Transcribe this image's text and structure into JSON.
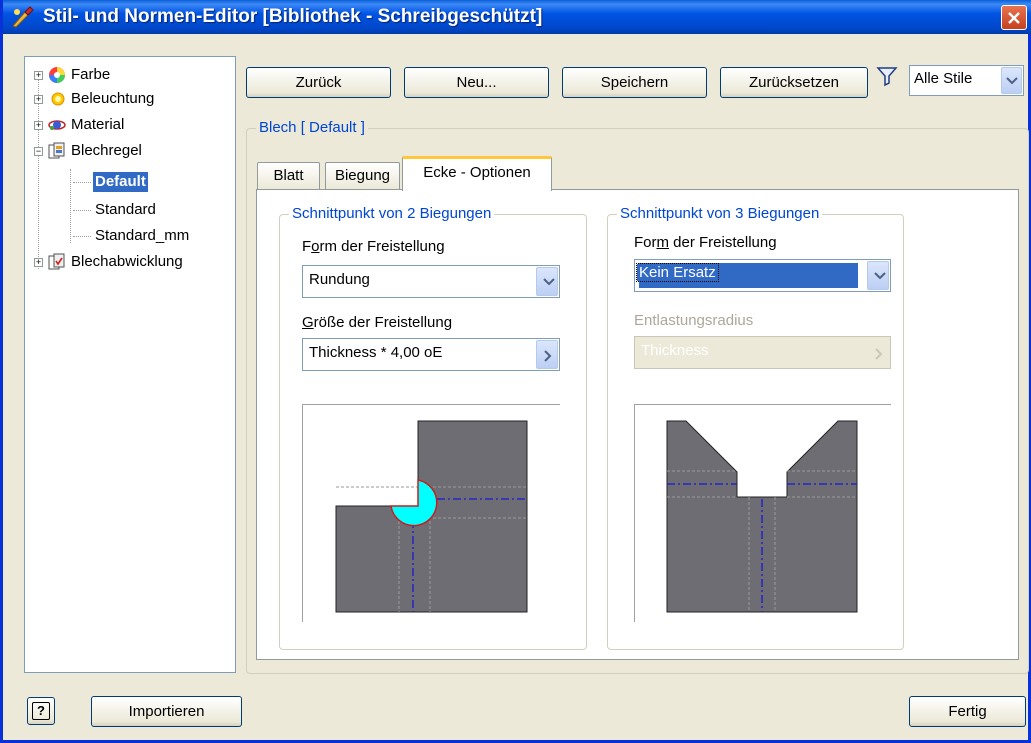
{
  "window": {
    "title": "Stil- und Normen-Editor [Bibliothek - Schreibgeschützt]"
  },
  "tree": {
    "items": [
      {
        "label": "Farbe"
      },
      {
        "label": "Beleuchtung"
      },
      {
        "label": "Material"
      },
      {
        "label": "Blechregel"
      },
      {
        "label": "Default"
      },
      {
        "label": "Standard"
      },
      {
        "label": "Standard_mm"
      },
      {
        "label": "Blechabwicklung"
      }
    ]
  },
  "toolbar": {
    "back_label": "Zurück",
    "new_label": "Neu...",
    "save_label": "Speichern",
    "reset_label": "Zurücksetzen",
    "filter_value": "Alle Stile"
  },
  "main": {
    "group_title": "Blech [ Default ]",
    "tabs": [
      {
        "label": "Blatt"
      },
      {
        "label": "Biegung"
      },
      {
        "label": "Ecke - Optionen"
      }
    ],
    "left": {
      "title": "Schnittpunkt von 2 Biegungen",
      "shape_label_pre": "F",
      "shape_label_u": "o",
      "shape_label_post": "rm der Freistellung",
      "shape_value": "Rundung",
      "size_label_u": "G",
      "size_label_post": "röße der Freistellung",
      "size_value": "Thickness * 4,00 oE"
    },
    "right": {
      "title": "Schnittpunkt von 3 Biegungen",
      "shape_label_pre": "For",
      "shape_label_u": "m",
      "shape_label_post": " der Freistellung",
      "shape_value": "Kein Ersatz",
      "radius_label": "Entlastungsradius",
      "radius_value": "Thickness"
    }
  },
  "footer": {
    "help_label": "?",
    "import_label": "Importieren",
    "done_label": "Fertig"
  },
  "colors": {
    "accent": "#0046d5",
    "shape_fill": "#6d6d73",
    "relief_fill": "#00ffff",
    "bend_line": "#1a1ad6"
  }
}
